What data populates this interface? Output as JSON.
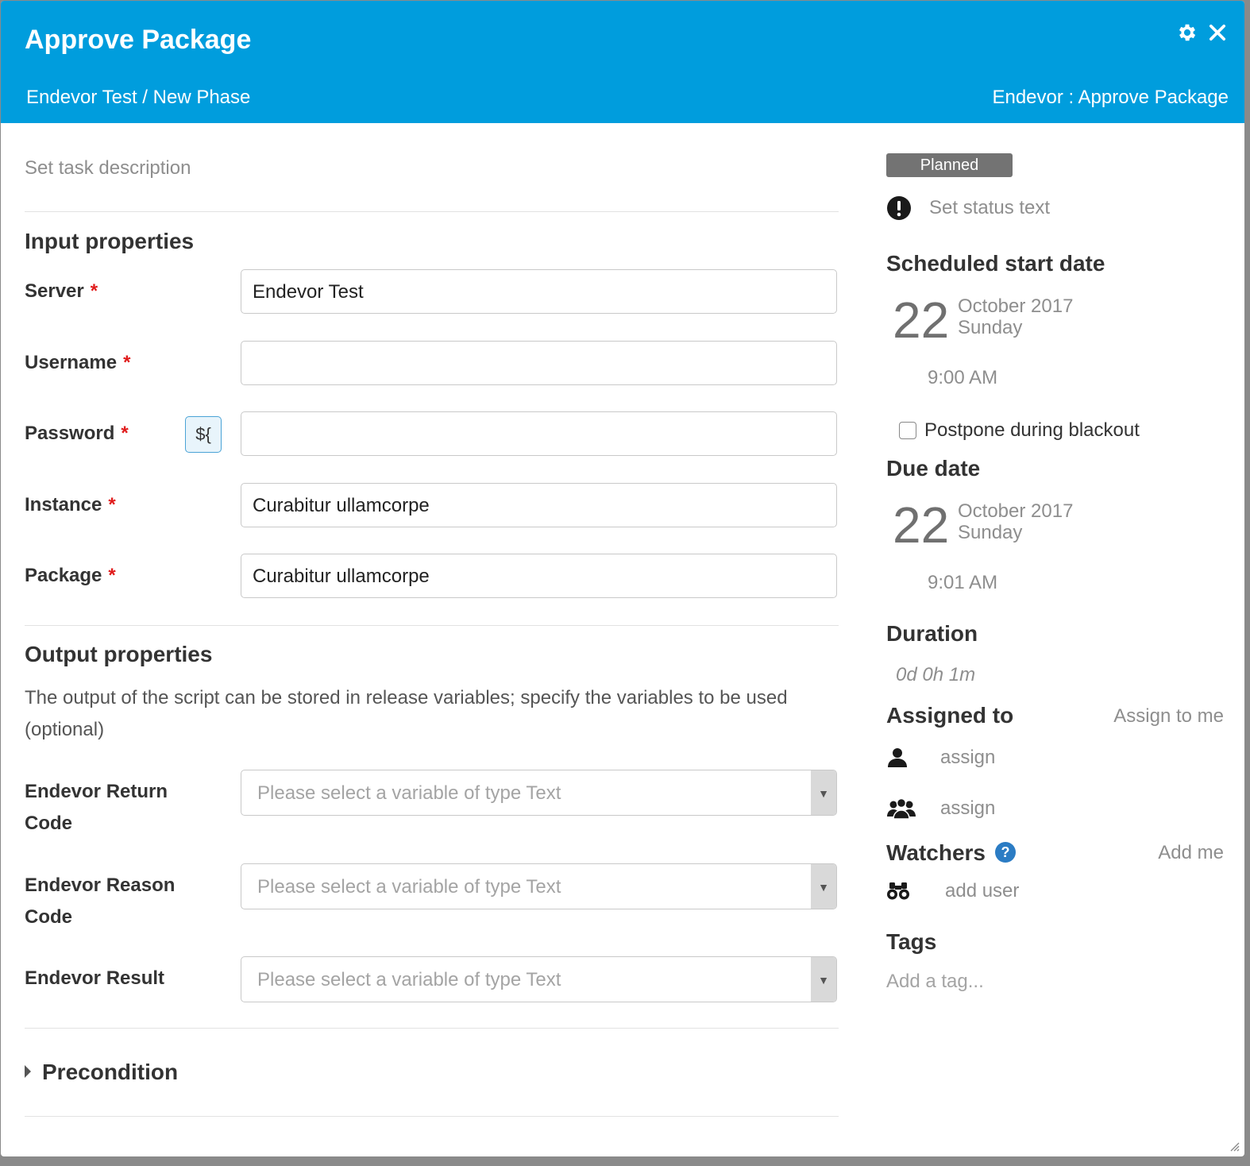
{
  "header": {
    "title": "Approve Package",
    "breadcrumb": "Endevor Test / New Phase",
    "task_type": "Endevor : Approve Package",
    "settings_icon": "gear-icon",
    "close_icon": "close-icon",
    "background": "#009ddd"
  },
  "description_placeholder": "Set task description",
  "input_properties": {
    "title": "Input properties",
    "required_mark": "*",
    "fields": {
      "server": {
        "label": "Server",
        "value": "Endevor Test"
      },
      "username": {
        "label": "Username",
        "value": ""
      },
      "password": {
        "label": "Password",
        "value": "",
        "variable_button": "${"
      },
      "instance": {
        "label": "Instance",
        "value": "Curabitur ullamcorpe"
      },
      "package": {
        "label": "Package",
        "value": "Curabitur ullamcorpe"
      }
    }
  },
  "output_properties": {
    "title": "Output properties",
    "description": "The output of the script can be stored in release variables; specify the variables to be used (optional)",
    "fields": {
      "return_code": {
        "label_line1": "Endevor Return",
        "label_line2": "Code",
        "placeholder": "Please select a variable of type Text"
      },
      "reason_code": {
        "label_line1": "Endevor Reason",
        "label_line2": "Code",
        "placeholder": "Please select a variable of type Text"
      },
      "result": {
        "label": "Endevor Result",
        "placeholder": "Please select a variable of type Text"
      }
    }
  },
  "precondition": {
    "label": "Precondition"
  },
  "sidebar": {
    "status_badge": "Planned",
    "status_text_placeholder": "Set status text",
    "scheduled_start": {
      "title": "Scheduled start date",
      "day": "22",
      "month_year": "October 2017",
      "weekday": "Sunday",
      "time": "9:00 AM"
    },
    "postpone_label": "Postpone during blackout",
    "postpone_checked": false,
    "due_date": {
      "title": "Due date",
      "day": "22",
      "month_year": "October 2017",
      "weekday": "Sunday",
      "time": "9:01 AM"
    },
    "duration": {
      "title": "Duration",
      "value": "0d 0h 1m"
    },
    "assigned_to": {
      "title": "Assigned to",
      "assign_to_me": "Assign to me",
      "user_placeholder": "assign",
      "team_placeholder": "assign"
    },
    "watchers": {
      "title": "Watchers",
      "add_me": "Add me",
      "add_user": "add user"
    },
    "tags": {
      "title": "Tags",
      "placeholder": "Add a tag..."
    }
  }
}
